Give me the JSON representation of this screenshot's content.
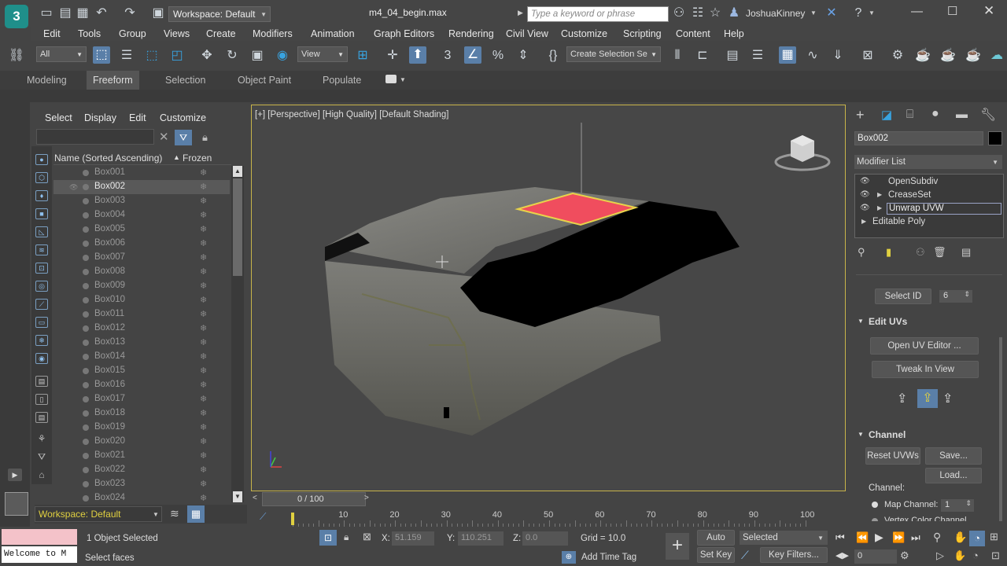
{
  "title": {
    "workspace": "Workspace: Default",
    "filename": "m4_04_begin.max",
    "search_placeholder": "Type a keyword or phrase",
    "user": "JoshuaKinney"
  },
  "menu": [
    "Edit",
    "Tools",
    "Group",
    "Views",
    "Create",
    "Modifiers",
    "Animation",
    "Graph Editors",
    "Rendering",
    "Civil View",
    "Customize",
    "Scripting",
    "Content",
    "Help"
  ],
  "toolbar": {
    "filter": "All",
    "refcoord": "View",
    "selection_set": "Create Selection Se"
  },
  "ribbon_tabs": [
    "Modeling",
    "Freeform",
    "Selection",
    "Object Paint",
    "Populate"
  ],
  "explorer": {
    "tabs": [
      "Select",
      "Display",
      "Edit",
      "Customize"
    ],
    "col_name": "Name (Sorted Ascending)",
    "col_frozen": "Frozen",
    "rows": [
      "Box001",
      "Box002",
      "Box003",
      "Box004",
      "Box005",
      "Box006",
      "Box007",
      "Box008",
      "Box009",
      "Box010",
      "Box011",
      "Box012",
      "Box013",
      "Box014",
      "Box015",
      "Box016",
      "Box017",
      "Box018",
      "Box019",
      "Box020",
      "Box021",
      "Box022",
      "Box023",
      "Box024"
    ],
    "selected": "Box002",
    "workspace": "Workspace: Default"
  },
  "viewport": {
    "label": "[+] [Perspective] [High Quality] [Default Shading]"
  },
  "cmd": {
    "object_name": "Box002",
    "modifier_list": "Modifier List",
    "stack": [
      "OpenSubdiv",
      "CreaseSet",
      "Unwrap UVW",
      "Editable Poly"
    ],
    "select_id_label": "Select ID",
    "select_id_value": "6",
    "edit_uvs_title": "Edit UVs",
    "open_uv_editor": "Open UV Editor ...",
    "tweak_in_view": "Tweak In View",
    "channel_title": "Channel",
    "reset_uvws": "Reset UVWs",
    "save": "Save...",
    "load": "Load...",
    "channel_label": "Channel:",
    "map_channel_label": "Map Channel:",
    "map_channel_value": "1",
    "vertex_color_channel": "Vertex Color Channel"
  },
  "timeline": {
    "frame": "0 / 100",
    "ticks": [
      "10",
      "20",
      "30",
      "40",
      "50",
      "60",
      "70",
      "80",
      "90",
      "100"
    ]
  },
  "status": {
    "listener": "Welcome to M",
    "selected": "1 Object Selected",
    "prompt": "Select faces",
    "x_label": "X:",
    "x": "51.159",
    "y_label": "Y:",
    "y": "110.251",
    "z_label": "Z:",
    "z": "0.0",
    "grid": "Grid = 10.0",
    "add_time_tag": "Add Time Tag",
    "auto_key": "Auto Key",
    "set_key": "Set Key",
    "key_mode": "Selected",
    "key_filters": "Key Filters...",
    "current_frame": "0"
  }
}
